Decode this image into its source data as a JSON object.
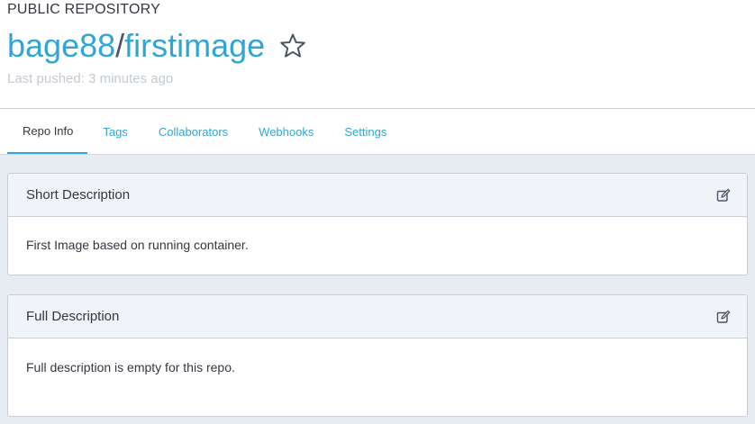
{
  "header": {
    "repo_kind": "PUBLIC REPOSITORY",
    "namespace": "bage88",
    "separator": "/",
    "repo": "firstimage",
    "last_pushed": "Last pushed: 3 minutes ago"
  },
  "tabs": [
    {
      "label": "Repo Info",
      "active": true
    },
    {
      "label": "Tags",
      "active": false
    },
    {
      "label": "Collaborators",
      "active": false
    },
    {
      "label": "Webhooks",
      "active": false
    },
    {
      "label": "Settings",
      "active": false
    }
  ],
  "panels": {
    "short": {
      "title": "Short Description",
      "body": "First Image based on running container."
    },
    "full": {
      "title": "Full Description",
      "body": "Full description is empty for this repo."
    }
  },
  "icons": {
    "star": "star-outline-icon",
    "edit": "edit-icon"
  },
  "colors": {
    "accent": "#2fa6d6",
    "text": "#333840",
    "muted": "#c3cad3",
    "background": "#e7ecf2"
  }
}
